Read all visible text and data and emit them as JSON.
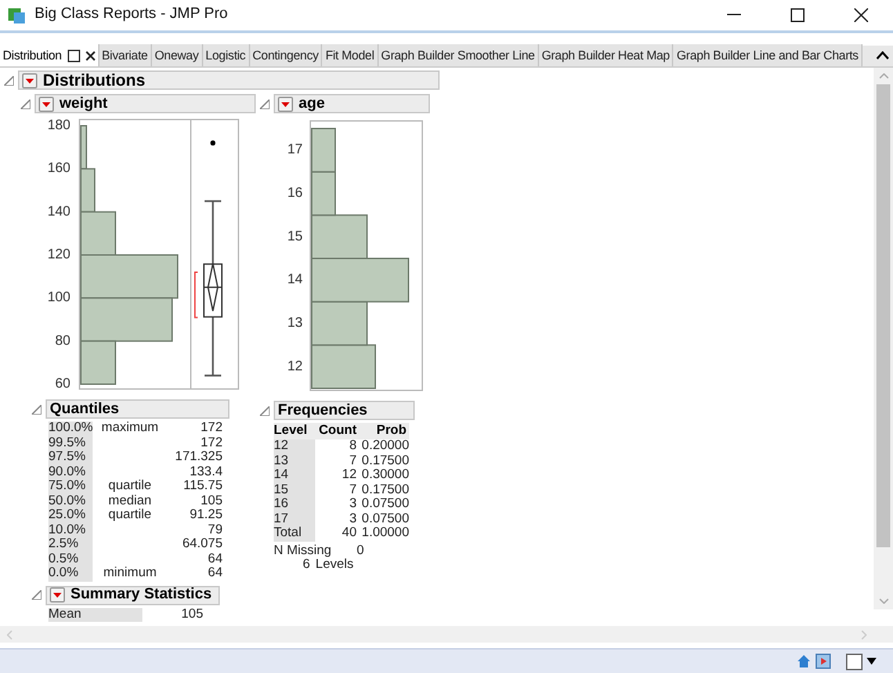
{
  "window": {
    "title": "Big Class Reports - JMP Pro"
  },
  "tabs": [
    {
      "label": "Distribution",
      "selected": true
    },
    {
      "label": "Bivariate",
      "selected": false
    },
    {
      "label": "Oneway",
      "selected": false
    },
    {
      "label": "Logistic",
      "selected": false
    },
    {
      "label": "Contingency",
      "selected": false
    },
    {
      "label": "Fit Model",
      "selected": false
    },
    {
      "label": "Graph Builder Smoother Line",
      "selected": false
    },
    {
      "label": "Graph Builder Heat Map",
      "selected": false
    },
    {
      "label": "Graph Builder Line and Bar Charts",
      "selected": false
    }
  ],
  "report": {
    "title": "Distributions"
  },
  "weight": {
    "title": "weight",
    "ticks": [
      "180",
      "160",
      "140",
      "120",
      "100",
      "80",
      "60"
    ]
  },
  "age": {
    "title": "age",
    "ticks": [
      "17",
      "16",
      "15",
      "14",
      "13",
      "12"
    ]
  },
  "quantiles": {
    "title": "Quantiles",
    "rows": [
      {
        "percent": "100.0%",
        "label": "maximum",
        "value": "172"
      },
      {
        "percent": "99.5%",
        "value": "172"
      },
      {
        "percent": "97.5%",
        "value": "171.325"
      },
      {
        "percent": "90.0%",
        "value": "133.4"
      },
      {
        "percent": "75.0%",
        "label": "quartile",
        "value": "115.75"
      },
      {
        "percent": "50.0%",
        "label": "median",
        "value": "105"
      },
      {
        "percent": "25.0%",
        "label": "quartile",
        "value": "91.25"
      },
      {
        "percent": "10.0%",
        "value": "79"
      },
      {
        "percent": "2.5%",
        "value": "64.075"
      },
      {
        "percent": "0.5%",
        "value": "64"
      },
      {
        "percent": "0.0%",
        "label": "minimum",
        "value": "64"
      }
    ]
  },
  "frequencies": {
    "title": "Frequencies",
    "columns": [
      "Level",
      "Count",
      "Prob"
    ],
    "rows": [
      {
        "level": "12",
        "count": "8",
        "prob": "0.20000"
      },
      {
        "level": "13",
        "count": "7",
        "prob": "0.17500"
      },
      {
        "level": "14",
        "count": "12",
        "prob": "0.30000"
      },
      {
        "level": "15",
        "count": "7",
        "prob": "0.17500"
      },
      {
        "level": "16",
        "count": "3",
        "prob": "0.07500"
      },
      {
        "level": "17",
        "count": "3",
        "prob": "0.07500"
      },
      {
        "level": "Total",
        "count": "40",
        "prob": "1.00000"
      }
    ],
    "n_missing": {
      "label": "N Missing",
      "value": "0"
    },
    "levels": {
      "count": "6",
      "label": "Levels"
    }
  },
  "summary": {
    "title": "Summary Statistics",
    "rows": [
      {
        "label": "Mean",
        "value": "105"
      }
    ]
  }
}
